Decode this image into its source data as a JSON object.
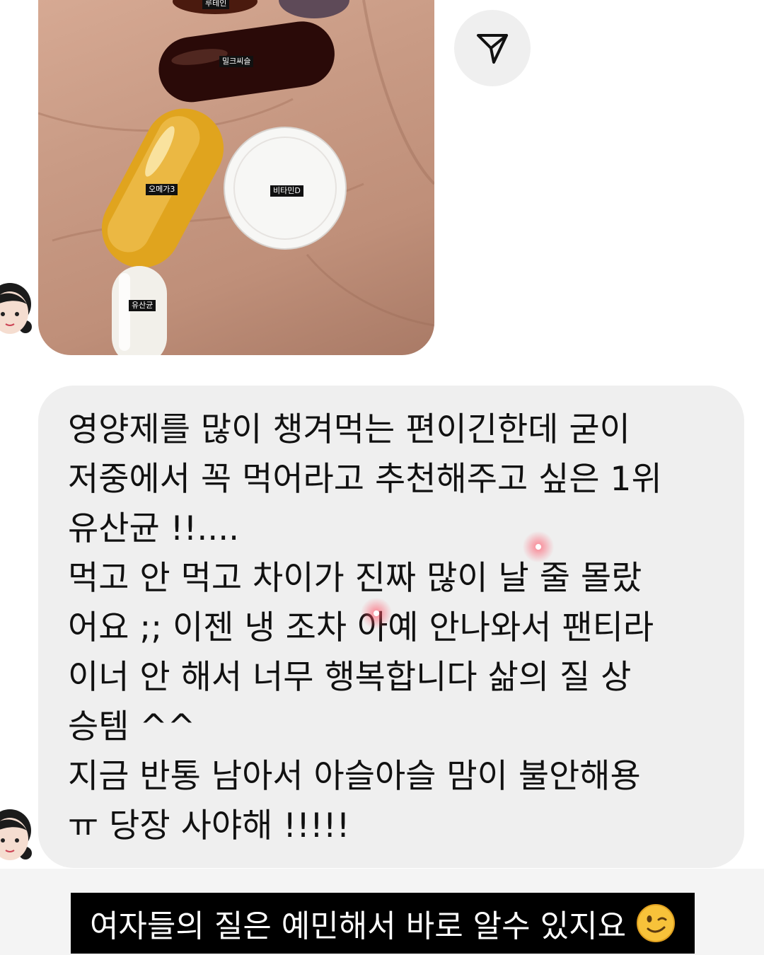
{
  "photo": {
    "labels": {
      "lutein": "루테인",
      "milk_thistle": "밀크씨슬",
      "omega3": "오메가3",
      "vitamin": "비타민D",
      "probiotic": "유산균"
    }
  },
  "message": {
    "text": "영양제를 많이 챙겨먹는 편이긴한데 굳이\n저중에서 꼭 먹어라고 추천해주고 싶은 1위\n유산균 !!....\n먹고 안 먹고 차이가 진짜 많이 날 줄 몰랐\n어요 ;; 이젠 냉 조차 아예 안나와서 팬티라\n이너 안 해서 너무 행복합니다 삶의 질 상\n승템 ^^\n지금 반통 남아서 아슬아슬 맘이 불안해용\nㅠ 당장 사야해 !!!!!"
  },
  "caption": {
    "text": "여자들의 질은 예민해서 바로 알수 있지요"
  },
  "colors": {
    "bubble_bg": "#efefef",
    "caption_bg": "#000000",
    "caption_text": "#ffffff"
  },
  "icons": [
    "send-icon",
    "girl-avatar-icon",
    "wink-emoji-icon"
  ]
}
